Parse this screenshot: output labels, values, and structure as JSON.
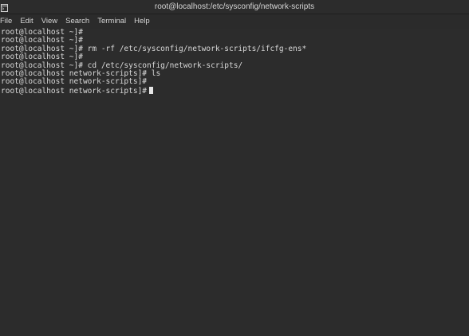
{
  "window": {
    "title": "root@localhost:/etc/sysconfig/network-scripts"
  },
  "menu": [
    {
      "label": "File"
    },
    {
      "label": "Edit"
    },
    {
      "label": "View"
    },
    {
      "label": "Search"
    },
    {
      "label": "Terminal"
    },
    {
      "label": "Help"
    }
  ],
  "terminal": {
    "lines": [
      "root@localhost ~]#",
      "root@localhost ~]#",
      "root@localhost ~]# rm -rf /etc/sysconfig/network-scripts/ifcfg-ens*",
      "root@localhost ~]#",
      "root@localhost ~]# cd /etc/sysconfig/network-scripts/",
      "root@localhost network-scripts]# ls",
      "root@localhost network-scripts]#",
      "root@localhost network-scripts]#"
    ]
  },
  "colors": {
    "background": "#2c2c2c",
    "text": "#d9d9d9"
  },
  "icons": {
    "window_icon": "terminal-icon"
  }
}
